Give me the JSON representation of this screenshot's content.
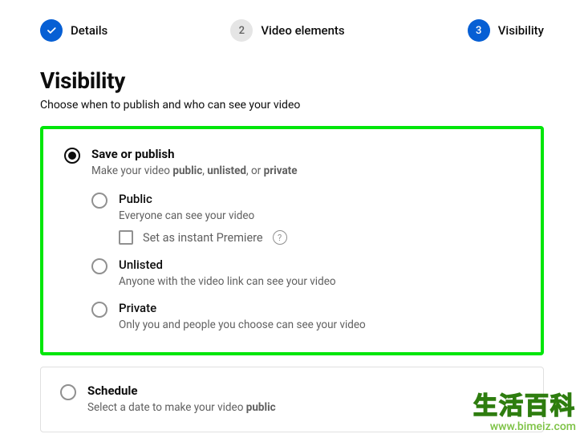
{
  "stepper": {
    "step1": {
      "label": "Details"
    },
    "step2": {
      "number": "2",
      "label": "Video elements"
    },
    "step3": {
      "number": "3",
      "label": "Visibility"
    }
  },
  "heading": {
    "title": "Visibility",
    "subtitle": "Choose when to publish and who can see your video"
  },
  "save_publish": {
    "title": "Save or publish",
    "desc_prefix": "Make your video ",
    "desc_bold1": "public",
    "desc_sep1": ", ",
    "desc_bold2": "unlisted",
    "desc_sep2": ", or ",
    "desc_bold3": "private",
    "options": {
      "public": {
        "title": "Public",
        "desc": "Everyone can see your video",
        "premiere_label": "Set as instant Premiere"
      },
      "unlisted": {
        "title": "Unlisted",
        "desc": "Anyone with the video link can see your video"
      },
      "private": {
        "title": "Private",
        "desc": "Only you and people you choose can see your video"
      }
    }
  },
  "schedule": {
    "title": "Schedule",
    "desc_prefix": "Select a date to make your video ",
    "desc_bold": "public"
  },
  "watermark": {
    "cn": "生活百科",
    "url": "www.bimeiz.com"
  }
}
